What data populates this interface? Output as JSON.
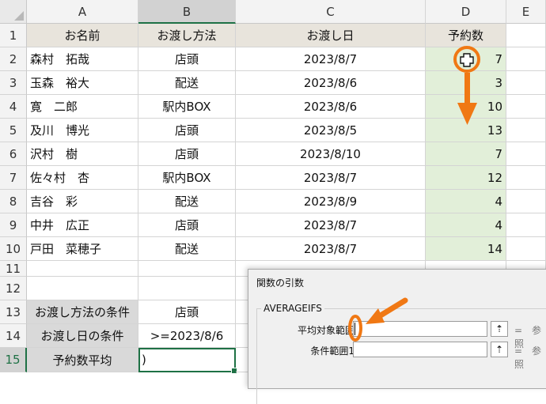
{
  "columns": [
    "A",
    "B",
    "C",
    "D",
    "E"
  ],
  "rows": [
    "1",
    "2",
    "3",
    "4",
    "5",
    "6",
    "7",
    "8",
    "9",
    "10",
    "11",
    "12",
    "13",
    "14",
    "15"
  ],
  "header": {
    "name": "お名前",
    "method": "お渡し方法",
    "date": "お渡し日",
    "count": "予約数"
  },
  "records": [
    {
      "name": "森村　拓哉",
      "method": "店頭",
      "date": "2023/8/7",
      "count": "7"
    },
    {
      "name": "玉森　裕大",
      "method": "配送",
      "date": "2023/8/6",
      "count": "3"
    },
    {
      "name": "寛　二郎",
      "method": "駅内BOX",
      "date": "2023/8/6",
      "count": "10"
    },
    {
      "name": "及川　博光",
      "method": "店頭",
      "date": "2023/8/5",
      "count": "13"
    },
    {
      "name": "沢村　樹",
      "method": "店頭",
      "date": "2023/8/10",
      "count": "7"
    },
    {
      "name": "佐々村　杏",
      "method": "駅内BOX",
      "date": "2023/8/7",
      "count": "12"
    },
    {
      "name": "吉谷　彩",
      "method": "配送",
      "date": "2023/8/9",
      "count": "4"
    },
    {
      "name": "中井　広正",
      "method": "店頭",
      "date": "2023/8/7",
      "count": "4"
    },
    {
      "name": "戸田　菜穂子",
      "method": "配送",
      "date": "2023/8/7",
      "count": "14"
    }
  ],
  "conditions": {
    "method_label": "お渡し方法の条件",
    "method_value": "店頭",
    "date_label": "お渡し日の条件",
    "date_value": ">=2023/8/6",
    "avg_label": "予約数平均",
    "avg_value": ")"
  },
  "dialog": {
    "title": "関数の引数",
    "function_name": "AVERAGEIFS",
    "arg1_label": "平均対象範囲",
    "arg2_label": "条件範囲1",
    "ref_button": "⇡",
    "eq1": "=　参照",
    "eq2": "=　参照"
  },
  "annotation_color": "#f07814",
  "icons": {
    "fill_cursor": "fill-cross-cursor-icon",
    "arrow_down": "arrow-down-icon",
    "arrow_pointer": "arrow-pointer-icon"
  }
}
